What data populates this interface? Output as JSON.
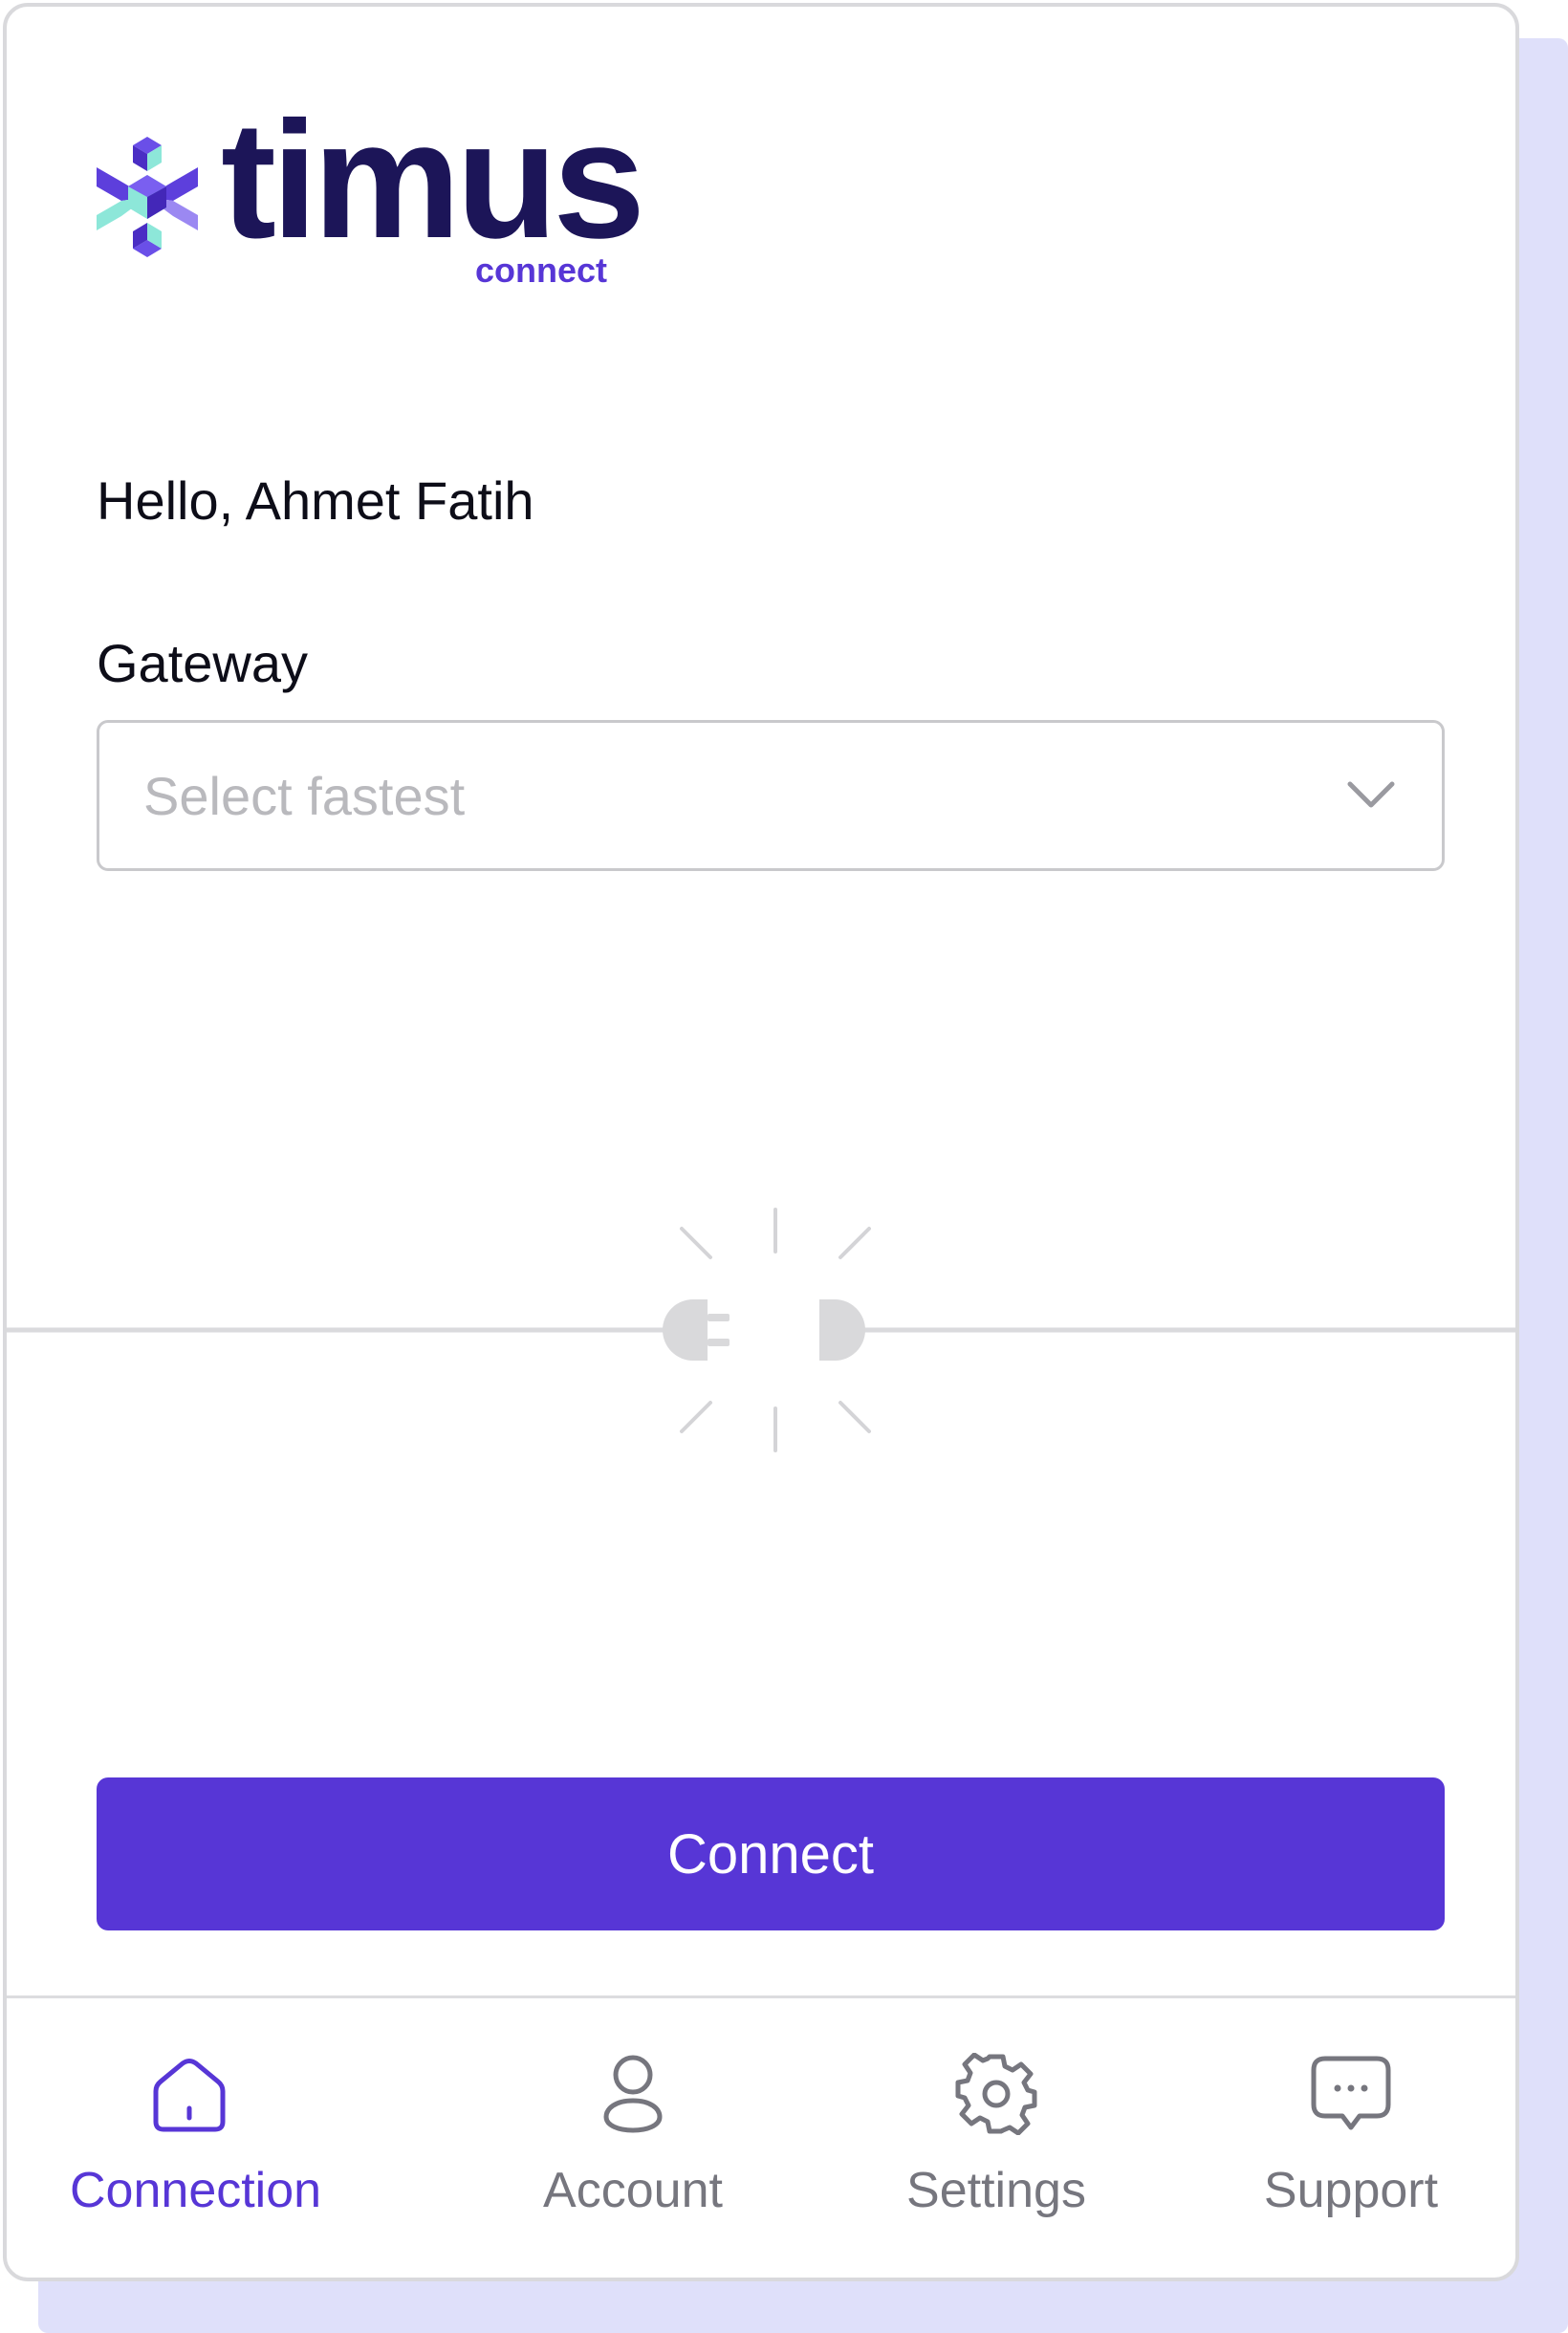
{
  "brand": {
    "name": "timus",
    "subtitle": "connect"
  },
  "greeting": "Hello, Ahmet Fatih",
  "gateway": {
    "label": "Gateway",
    "selected": "Select fastest"
  },
  "status_graphic": {
    "icon": "unplugged-icon",
    "state": "disconnected"
  },
  "connect_button": {
    "label": "Connect"
  },
  "nav": {
    "items": [
      {
        "label": "Connection",
        "icon": "home-icon",
        "active": true
      },
      {
        "label": "Account",
        "icon": "user-icon",
        "active": false
      },
      {
        "label": "Settings",
        "icon": "gear-icon",
        "active": false
      },
      {
        "label": "Support",
        "icon": "chat-icon",
        "active": false
      }
    ]
  },
  "colors": {
    "accent": "#5736d6",
    "brand_dark": "#1c1558",
    "brand_teal": "#8de7d9",
    "inactive": "#76767e",
    "placeholder": "#b9b9bd",
    "shadow": "#dfe0fa"
  }
}
